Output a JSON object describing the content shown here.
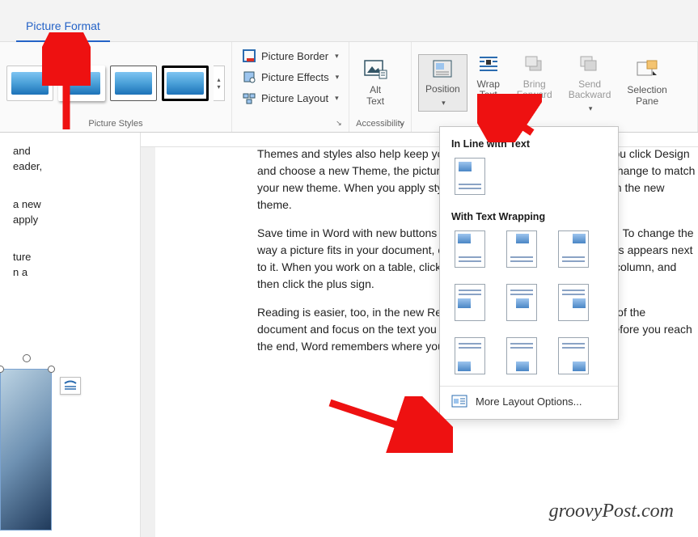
{
  "tab_active": "Picture Format",
  "ribbon": {
    "styles_group": "Picture Styles",
    "border_label": "Picture Border",
    "effects_label": "Picture Effects",
    "layout_label": "Picture Layout",
    "accessibility_group": "Accessibility",
    "alt_text": "Alt\nText",
    "position": "Position",
    "wrap_text": "Wrap\nText",
    "bring_forward": "Bring\nForward",
    "send_backward": "Send\nBackward",
    "selection_pane": "Selection\nPane"
  },
  "doc": {
    "left_frag_1": "and",
    "left_frag_2": "eader,",
    "left_frag_3": "a new",
    "left_frag_4": "apply",
    "left_frag_5": "ture",
    "left_frag_6": "n a",
    "p1": "Themes and styles also help keep your document coordinated. When you click Design and choose a new Theme, the pictures, charts, and SmartArt graphics change to match your new theme. When you apply styles, your headings change to match the new theme.",
    "p2": "Save time in Word with new buttons that show up where you need them. To change the way a picture fits in your document, click it and a button for layout options appears next to it. When you work on a table, click where you want to add a row or a column, and then click the plus sign.",
    "p3": "Reading is easier, too, in the new Reading view. You can collapse parts of the document and focus on the text you want. If you need to stop reading before you reach the end, Word remembers where you left off - even on another device."
  },
  "dropdown": {
    "section1": "In Line with Text",
    "section2": "With Text Wrapping",
    "more": "More Layout Options..."
  },
  "watermark": "groovyPost.com"
}
